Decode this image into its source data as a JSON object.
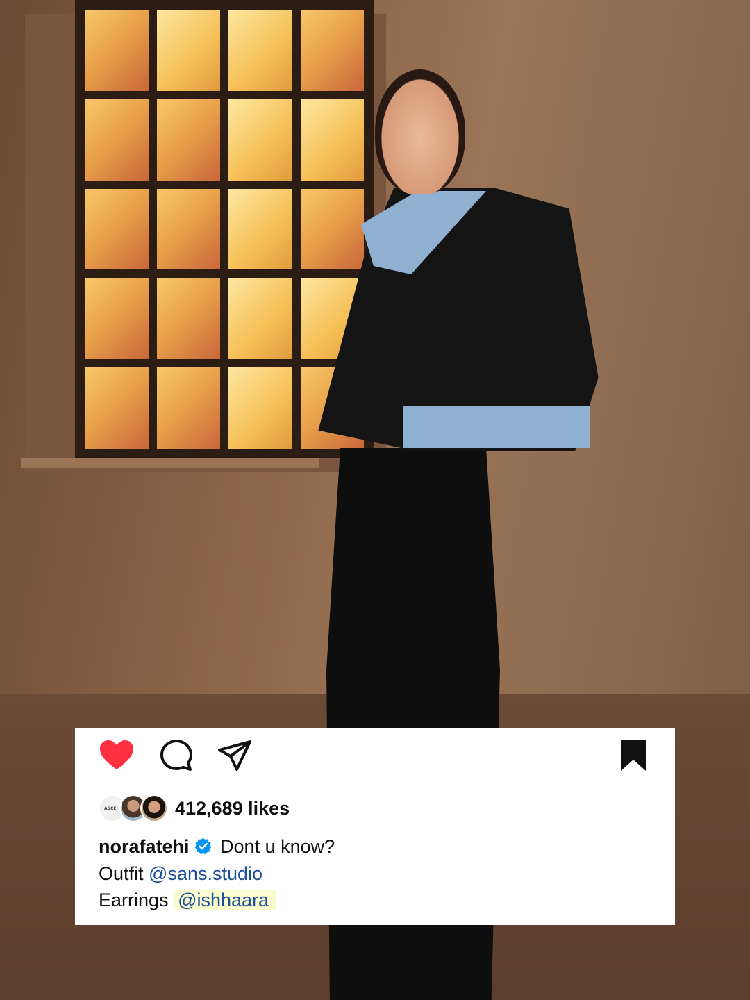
{
  "post": {
    "likes_text": "412,689 likes",
    "avatar_label": "ASCEI",
    "username": "norafatehi",
    "caption_first_line": "Dont u know?",
    "line2_label": "Outfit",
    "line2_mention": "@sans.studio",
    "line3_label": "Earrings",
    "line3_mention": "@ishhaara"
  },
  "icons": {
    "like": "heart-filled-icon",
    "comment": "comment-bubble-icon",
    "share": "paper-plane-icon",
    "save": "bookmark-filled-icon",
    "verified": "verified-badge-icon"
  },
  "colors": {
    "like_red": "#ff3040",
    "verified_blue": "#0095f6",
    "mention_blue": "#1b4f9a",
    "highlight": "#fbfbd0"
  }
}
